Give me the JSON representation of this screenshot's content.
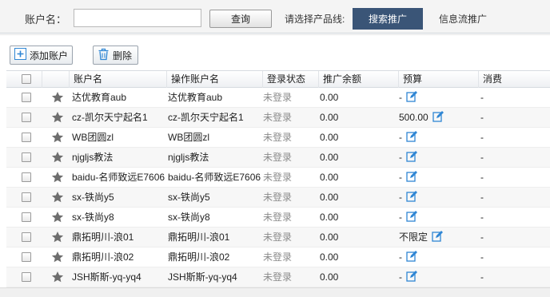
{
  "search": {
    "account_label": "账户名：",
    "account_value": "",
    "query_label": "查询",
    "product_line_label": "请选择产品线:",
    "tabs": [
      {
        "label": "搜索推广",
        "active": true
      },
      {
        "label": "信息流推广",
        "active": false
      }
    ]
  },
  "toolbar": {
    "add_label": "添加账户",
    "delete_label": "删除"
  },
  "table": {
    "columns": [
      "账户名",
      "操作账户名",
      "登录状态",
      "推广余额",
      "预算",
      "消费"
    ],
    "rows": [
      {
        "account": "达优教育aub",
        "operator": "达优教育aub",
        "status": "未登录",
        "balance": "0.00",
        "budget": "-",
        "spend": "-"
      },
      {
        "account": "cz-凯尔天宁起名1",
        "operator": "cz-凯尔天宁起名1",
        "status": "未登录",
        "balance": "0.00",
        "budget": "500.00",
        "spend": "-"
      },
      {
        "account": "WB团圆zl",
        "operator": "WB团圆zl",
        "status": "未登录",
        "balance": "0.00",
        "budget": "-",
        "spend": "-"
      },
      {
        "account": "njgljs教法",
        "operator": "njgljs教法",
        "status": "未登录",
        "balance": "0.00",
        "budget": "-",
        "spend": "-"
      },
      {
        "account": "baidu-名师致远E7606",
        "operator": "baidu-名师致远E7606",
        "status": "未登录",
        "balance": "0.00",
        "budget": "-",
        "spend": "-"
      },
      {
        "account": "sx-铁尚y5",
        "operator": "sx-铁尚y5",
        "status": "未登录",
        "balance": "0.00",
        "budget": "-",
        "spend": "-"
      },
      {
        "account": "sx-铁尚y8",
        "operator": "sx-铁尚y8",
        "status": "未登录",
        "balance": "0.00",
        "budget": "-",
        "spend": "-"
      },
      {
        "account": "鼎拓明川-浪01",
        "operator": "鼎拓明川-浪01",
        "status": "未登录",
        "balance": "0.00",
        "budget": "不限定",
        "spend": "-"
      },
      {
        "account": "鼎拓明川-浪02",
        "operator": "鼎拓明川-浪02",
        "status": "未登录",
        "balance": "0.00",
        "budget": "-",
        "spend": "-"
      },
      {
        "account": "JSH斯斯-yq-yq4",
        "operator": "JSH斯斯-yq-yq4",
        "status": "未登录",
        "balance": "0.00",
        "budget": "-",
        "spend": "-"
      }
    ]
  },
  "icons": {
    "add": "plus-square-icon",
    "delete": "trash-icon",
    "star": "star-icon",
    "edit": "edit-icon"
  },
  "colors": {
    "active_tab": "#3a5577",
    "icon_blue": "#2f86d4",
    "star_gray": "#6e6e6e"
  }
}
